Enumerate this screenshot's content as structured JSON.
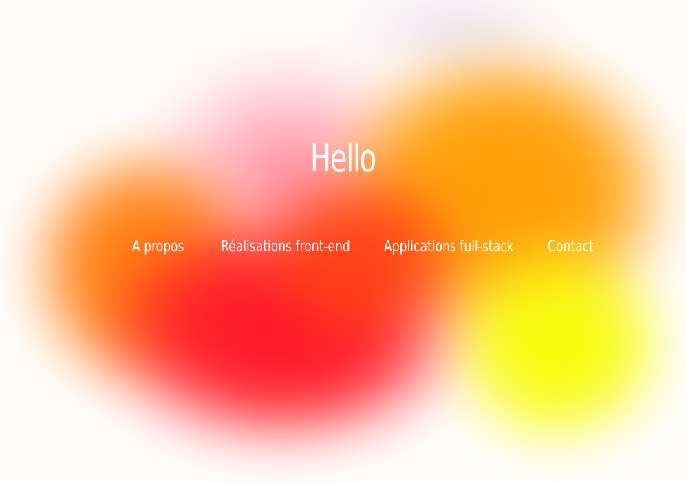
{
  "hero": {
    "title": "Hello"
  },
  "nav": {
    "items": [
      {
        "label": "A propos"
      },
      {
        "label": "Réalisations front-end"
      },
      {
        "label": "Applications full-stack"
      },
      {
        "label": "Contact"
      }
    ]
  },
  "colors": {
    "text": "#ffffff",
    "background": "#fffdfb",
    "blob_pink": "#ff788c",
    "blob_orange": "#ff9b00",
    "blob_orange_left": "#ff7a0a",
    "blob_red": "#ff1025",
    "blob_yellow": "#f7ff00"
  }
}
